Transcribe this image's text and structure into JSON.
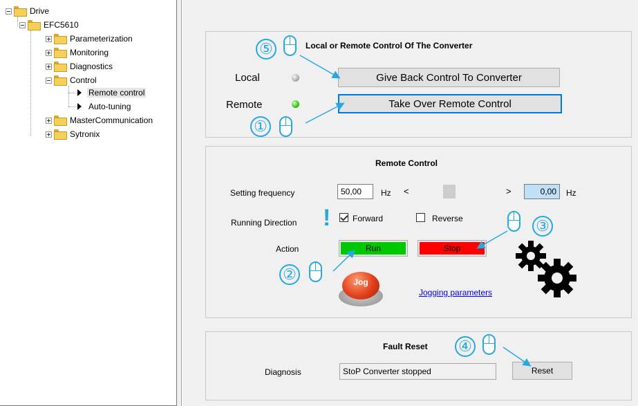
{
  "tree": {
    "items": [
      {
        "label": "Drive"
      },
      {
        "label": "EFC5610"
      },
      {
        "label": "Parameterization"
      },
      {
        "label": "Monitoring"
      },
      {
        "label": "Diagnostics"
      },
      {
        "label": "Control"
      },
      {
        "label": "Remote control"
      },
      {
        "label": "Auto-tuning"
      },
      {
        "label": "MasterCommunication"
      },
      {
        "label": "Sytronix"
      }
    ],
    "selected": "Remote control"
  },
  "local_remote": {
    "title": "Local or Remote Control Of The Converter",
    "local_label": "Local",
    "remote_label": "Remote",
    "give_back_button": "Give Back Control To Converter",
    "take_over_button": "Take Over Remote Control",
    "local_led_state": "off",
    "remote_led_state": "on"
  },
  "remote_control": {
    "title": "Remote Control",
    "frequency_label": "Setting frequency",
    "frequency_value": "50,00",
    "frequency_unit": "Hz",
    "slider_left": "<",
    "slider_right": ">",
    "actual_value": "0,00",
    "actual_unit": "Hz",
    "direction_label": "Running Direction",
    "forward_label": "Forward",
    "forward_checked": true,
    "reverse_label": "Reverse",
    "reverse_checked": false,
    "action_label": "Action",
    "run_label": "Run",
    "stop_label": "Stop",
    "jog_label": "Jog",
    "jogging_link": "Jogging parameters",
    "warning_mark": "!"
  },
  "fault_reset": {
    "title": "Fault Reset",
    "diagnosis_label": "Diagnosis",
    "diagnosis_value": "StoP Converter stopped",
    "reset_label": "Reset"
  },
  "callouts": {
    "step1": "①",
    "step2": "②",
    "step3": "③",
    "step4": "④",
    "step5": "⑤"
  },
  "colors": {
    "run": "#00c800",
    "stop": "#ff0000",
    "callout": "#29a8e0",
    "jog": "#e0401c"
  }
}
